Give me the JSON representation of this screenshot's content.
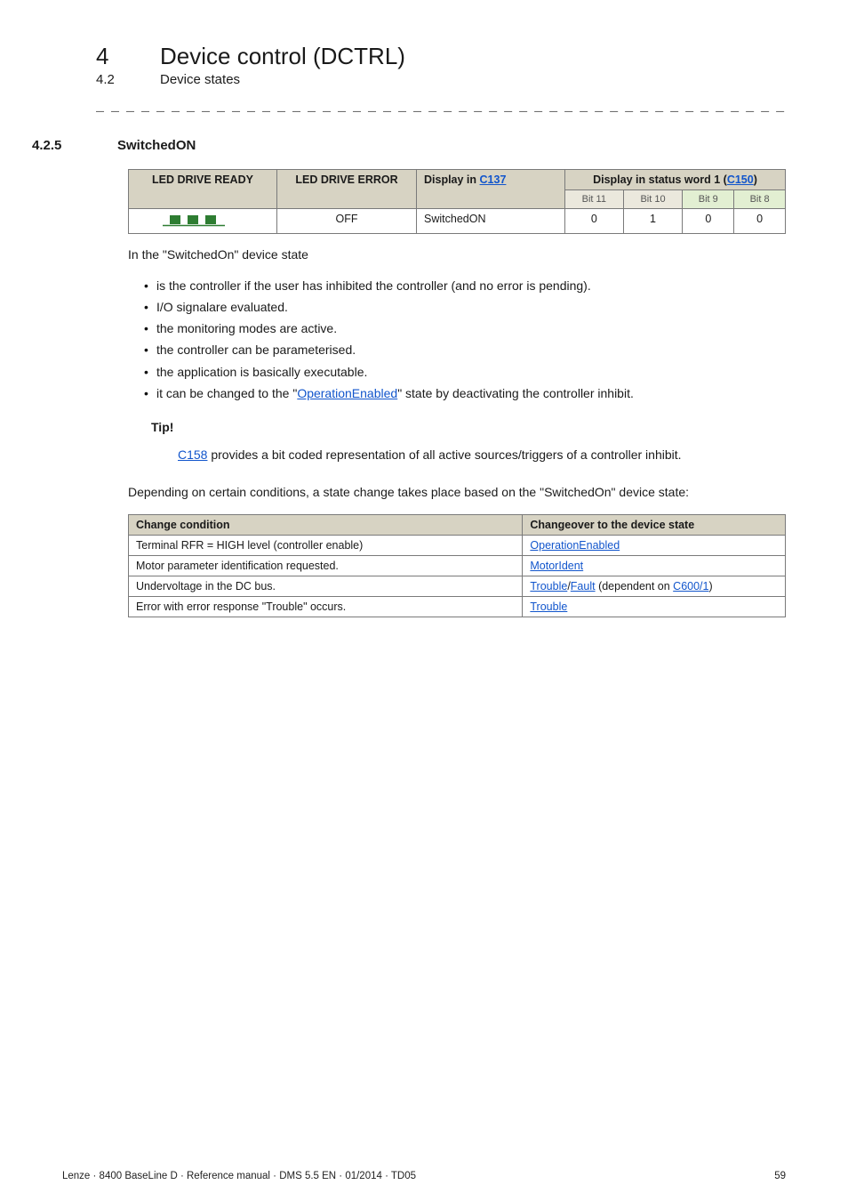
{
  "header": {
    "chapter_num": "4",
    "chapter_title": "Device control (DCTRL)",
    "sub_num": "4.2",
    "sub_title": "Device states"
  },
  "dashes": "_ _ _ _ _ _ _ _ _ _ _ _ _ _ _ _ _ _ _ _ _ _ _ _ _ _ _ _ _ _ _ _ _ _ _ _ _ _ _ _ _ _ _ _ _ _ _ _ _ _ _ _ _ _ _ _ _ _ _ _ _ _ _ _",
  "section": {
    "num": "4.2.5",
    "title": "SwitchedON"
  },
  "table1": {
    "headers": {
      "c1": "LED DRIVE READY",
      "c2": "LED DRIVE ERROR",
      "c3_pre": "Display in ",
      "c3_link": "C137",
      "c4_pre": "Display in status word 1 (",
      "c4_link": "C150",
      "c4_post": ")",
      "bit11": "Bit 11",
      "bit10": "Bit 10",
      "bit9": "Bit 9",
      "bit8": "Bit 8"
    },
    "row": {
      "led_error": "OFF",
      "display": "SwitchedON",
      "b11": "0",
      "b10": "1",
      "b9": "0",
      "b8": "0"
    }
  },
  "intro": "In the \"SwitchedOn\" device state",
  "bullets": [
    "is the controller if the user has inhibited the controller (and no error is pending).",
    "I/O signalare evaluated.",
    "the monitoring modes are active.",
    "the controller can be parameterised.",
    "the application is basically executable."
  ],
  "bullet_last": {
    "pre": "it can be changed to the \"",
    "link": "OperationEnabled",
    "post": "\" state by deactivating the controller inhibit."
  },
  "tip": {
    "label": "Tip!",
    "link": "C158",
    "rest": " provides a bit coded representation of all active sources/triggers of a controller inhibit."
  },
  "para2": "Depending on certain conditions, a state change takes place based on the \"SwitchedOn\" device state:",
  "table2": {
    "h1": "Change condition",
    "h2": "Changeover to the device state",
    "rows": [
      {
        "cond": "Terminal RFR = HIGH level (controller enable)",
        "link1": "OperationEnabled"
      },
      {
        "cond": "Motor parameter identification requested.",
        "link1": "MotorIdent"
      },
      {
        "cond": "Undervoltage in the DC bus.",
        "link1": "Trouble",
        "sep": "/",
        "link2": "Fault",
        "mid": " (dependent on ",
        "link3": "C600/1",
        "end": ")"
      },
      {
        "cond": "Error with error response \"Trouble\" occurs.",
        "link1": "Trouble"
      }
    ]
  },
  "footer": {
    "left": "Lenze · 8400 BaseLine D · Reference manual · DMS 5.5 EN · 01/2014 · TD05",
    "right": "59"
  }
}
